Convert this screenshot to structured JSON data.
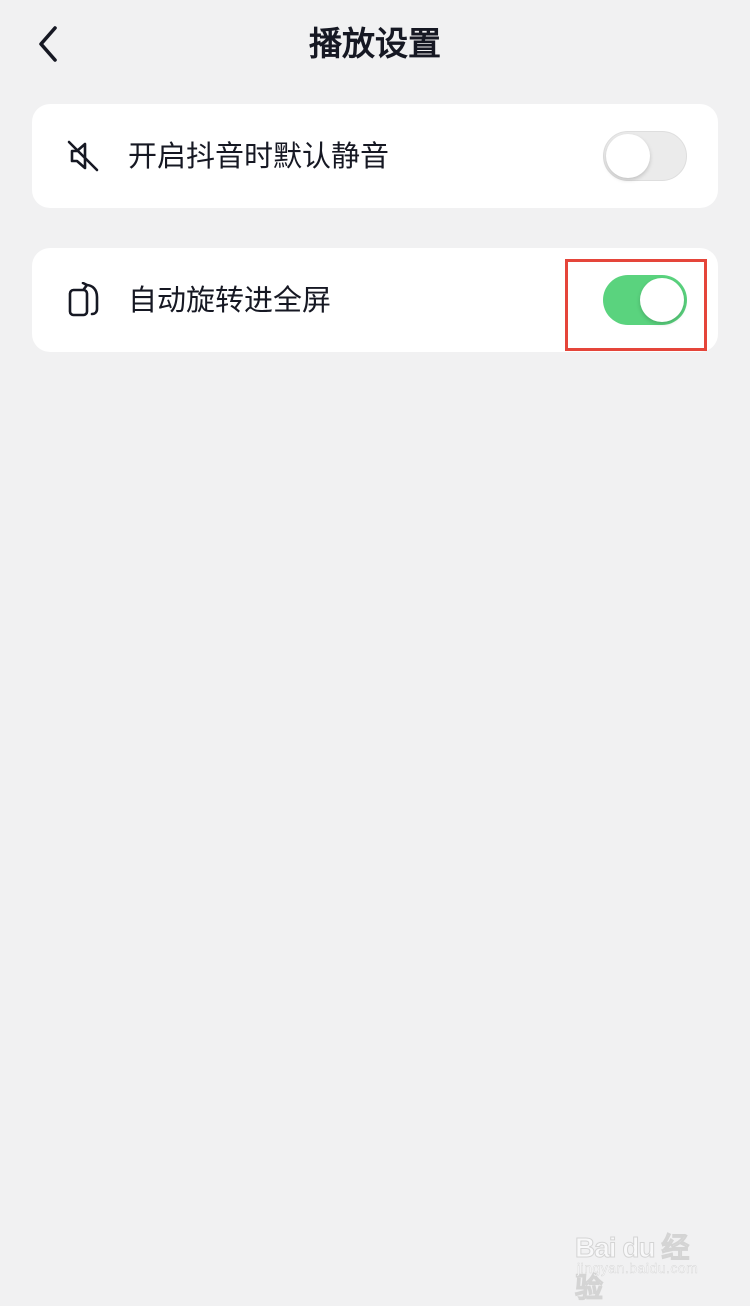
{
  "header": {
    "title": "播放设置",
    "back_icon": "chevron-left-icon"
  },
  "settings": [
    {
      "label": "开启抖音时默认静音",
      "icon": "speaker-muted-icon",
      "enabled": false
    },
    {
      "label": "自动旋转进全屏",
      "icon": "rotate-screen-icon",
      "enabled": true
    }
  ],
  "colors": {
    "background": "#f1f1f2",
    "card": "#ffffff",
    "text": "#161823",
    "toggle_on": "#5ad37e",
    "toggle_off": "#ebebeb",
    "highlight": "#e5453a"
  },
  "watermark": {
    "logo": "Bai du 经验",
    "url": "jingyan.baidu.com"
  }
}
